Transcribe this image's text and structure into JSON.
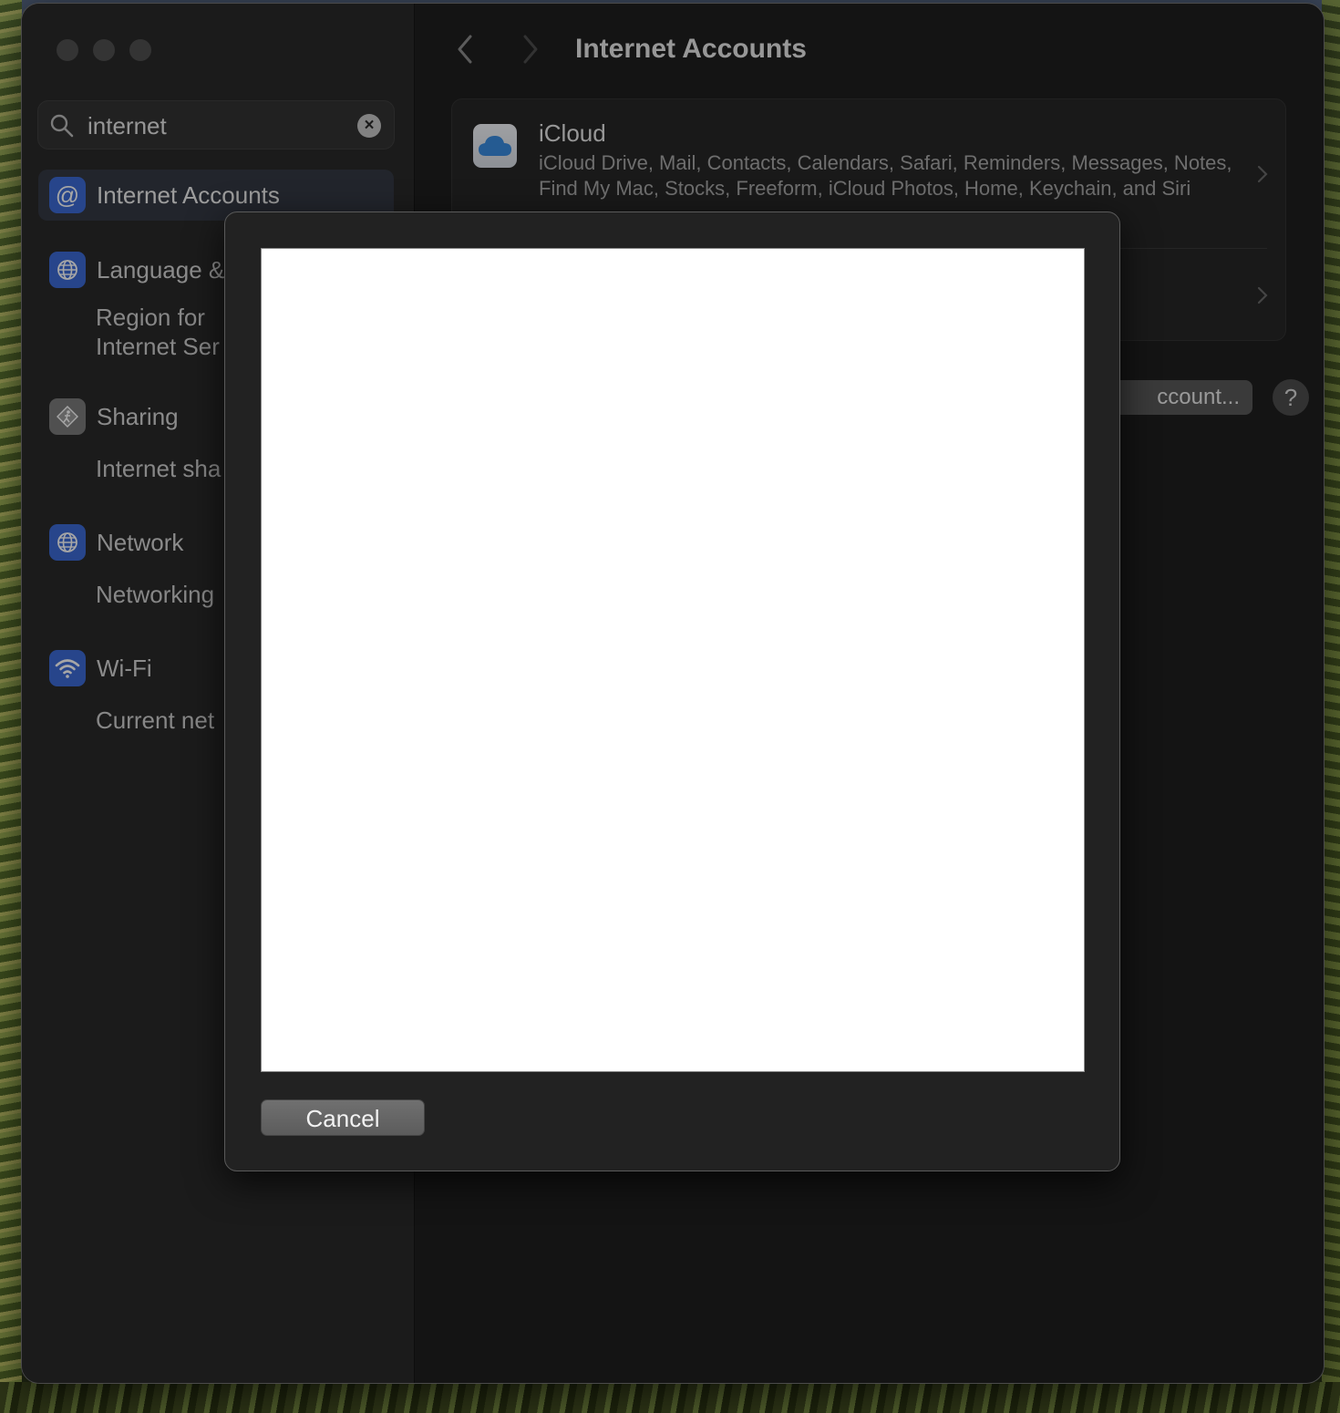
{
  "search": {
    "value": "internet",
    "icon": "magnifying-glass"
  },
  "sidebar": {
    "items": [
      {
        "label": "Internet Accounts",
        "icon": "at-sign",
        "selected": true
      },
      {
        "label": "Language &",
        "icon": "globe",
        "sub": [
          "Region for",
          "Internet Ser"
        ]
      },
      {
        "label": "Sharing",
        "icon": "sharing-walker",
        "sub": [
          "Internet sha"
        ]
      },
      {
        "label": "Network",
        "icon": "globe",
        "sub": [
          "Networking"
        ]
      },
      {
        "label": "Wi-Fi",
        "icon": "wifi",
        "sub": [
          "Current net"
        ]
      }
    ]
  },
  "header": {
    "title": "Internet Accounts"
  },
  "accounts": [
    {
      "name": "iCloud",
      "icon": "cloud",
      "description": "iCloud Drive, Mail, Contacts, Calendars, Safari, Reminders, Messages, Notes, Find My Mac, Stocks, Freeform, iCloud Photos, Home, Keychain, and Siri"
    }
  ],
  "buttons": {
    "add_account": "ccount...",
    "help": "?"
  },
  "sheet": {
    "cancel_label": "Cancel"
  },
  "colors": {
    "accent_blue": "#3d6bd6",
    "sheet_bg": "#222222"
  }
}
